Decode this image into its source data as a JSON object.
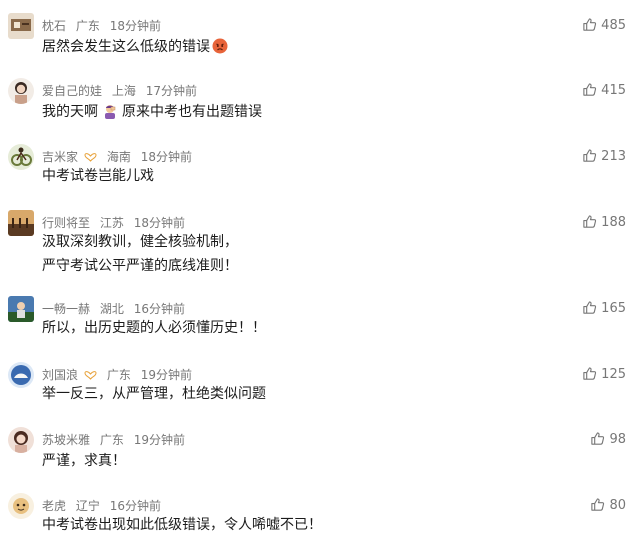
{
  "comments": [
    {
      "user": "枕石",
      "region": "广东",
      "time": "18分钟前",
      "likes": "485",
      "lines": [
        "居然会发生这么低级的错误"
      ],
      "emoji": "angry-face",
      "avatar_color": "#8a6a4a"
    },
    {
      "user": "爱自己的娃",
      "region": "上海",
      "time": "17分钟前",
      "likes": "415",
      "lines": [
        "我的天啊",
        "原来中考也有出题错误"
      ],
      "emoji": "facepalm-person",
      "avatar_color": "#c9a08a"
    },
    {
      "user": "吉米家",
      "region": "海南",
      "time": "18分钟前",
      "likes": "213",
      "lines": [
        "中考试卷岂能儿戏"
      ],
      "badge": "fan-badge",
      "avatar_color": "#6a7a3a"
    },
    {
      "user": "行则将至",
      "region": "江苏",
      "time": "18分钟前",
      "likes": "188",
      "lines": [
        "汲取深刻教训，健全核验机制，",
        "严守考试公平严谨的底线准则！"
      ],
      "avatar_color": "#7a5a3a"
    },
    {
      "user": "一畅一赫",
      "region": "湖北",
      "time": "16分钟前",
      "likes": "165",
      "lines": [
        "所以，出历史题的人必须懂历史！！"
      ],
      "avatar_color": "#3a5a8a"
    },
    {
      "user": "刘国浪",
      "region": "广东",
      "time": "19分钟前",
      "likes": "125",
      "lines": [
        "举一反三，从严管理，杜绝类似问题"
      ],
      "badge": "fan-badge",
      "avatar_color": "#3a6ab0"
    },
    {
      "user": "苏坡米雅",
      "region": "广东",
      "time": "19分钟前",
      "likes": "98",
      "lines": [
        "严谨，求真！"
      ],
      "avatar_color": "#d8b0a0"
    },
    {
      "user": "老虎",
      "region": "辽宁",
      "time": "16分钟前",
      "likes": "80",
      "lines": [
        "中考试卷出现如此低级错误，令人唏嘘不已！"
      ],
      "avatar_color": "#e8c080"
    }
  ]
}
